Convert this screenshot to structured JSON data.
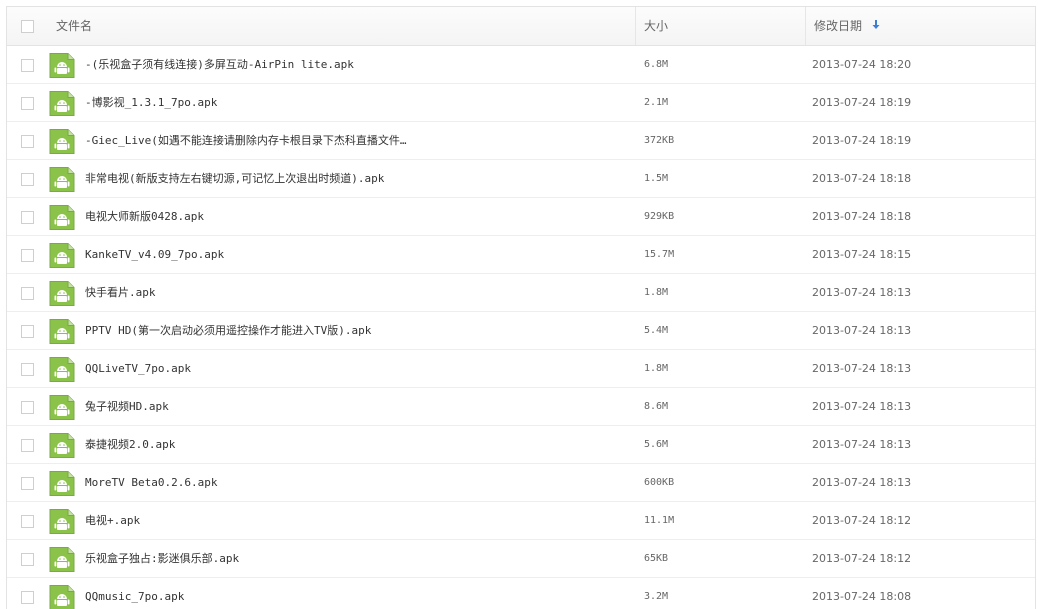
{
  "header": {
    "name": "文件名",
    "size": "大小",
    "date": "修改日期",
    "sort_icon": "arrow-down-icon"
  },
  "colors": {
    "icon_green": "#8bc34a",
    "icon_border": "#7aa84a",
    "accent": "#3b7fd4"
  },
  "files": [
    {
      "name": "-(乐视盒子须有线连接)多屏互动-AirPin lite.apk",
      "size": "6.8M",
      "date": "2013-07-24 18:20"
    },
    {
      "name": "-博影视_1.3.1_7po.apk",
      "size": "2.1M",
      "date": "2013-07-24 18:19"
    },
    {
      "name": "-Giec_Live(如遇不能连接请删除内存卡根目录下杰科直播文件…",
      "size": "372KB",
      "date": "2013-07-24 18:19"
    },
    {
      "name": "非常电视(新版支持左右键切源,可记忆上次退出时频道).apk",
      "size": "1.5M",
      "date": "2013-07-24 18:18"
    },
    {
      "name": "电视大师新版0428.apk",
      "size": "929KB",
      "date": "2013-07-24 18:18"
    },
    {
      "name": "KankeTV_v4.09_7po.apk",
      "size": "15.7M",
      "date": "2013-07-24 18:15"
    },
    {
      "name": "快手看片.apk",
      "size": "1.8M",
      "date": "2013-07-24 18:13"
    },
    {
      "name": "PPTV HD(第一次启动必须用遥控操作才能进入TV版).apk",
      "size": "5.4M",
      "date": "2013-07-24 18:13"
    },
    {
      "name": "QQLiveTV_7po.apk",
      "size": "1.8M",
      "date": "2013-07-24 18:13"
    },
    {
      "name": "兔子视频HD.apk",
      "size": "8.6M",
      "date": "2013-07-24 18:13"
    },
    {
      "name": "泰捷视频2.0.apk",
      "size": "5.6M",
      "date": "2013-07-24 18:13"
    },
    {
      "name": "MoreTV Beta0.2.6.apk",
      "size": "600KB",
      "date": "2013-07-24 18:13"
    },
    {
      "name": "电视+.apk",
      "size": "11.1M",
      "date": "2013-07-24 18:12"
    },
    {
      "name": "乐视盒子独占:影迷俱乐部.apk",
      "size": "65KB",
      "date": "2013-07-24 18:12"
    },
    {
      "name": "QQmusic_7po.apk",
      "size": "3.2M",
      "date": "2013-07-24 18:08"
    }
  ]
}
